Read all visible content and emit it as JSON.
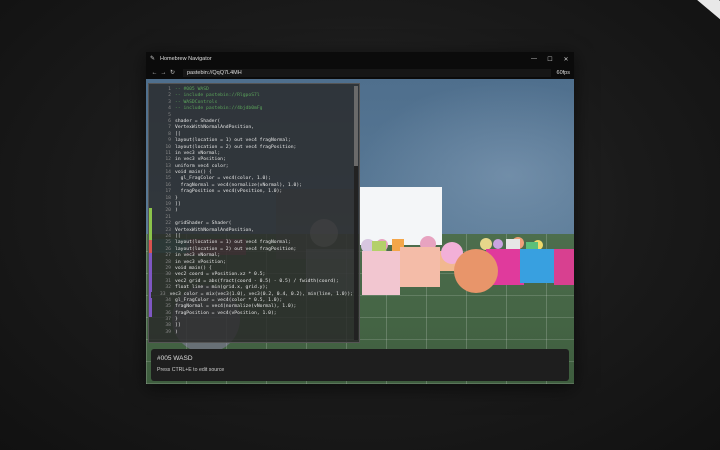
{
  "window": {
    "title": "Homebrew Navigator",
    "controls": {
      "minimize": "—",
      "maximize": "☐",
      "close": "✕"
    }
  },
  "navbar": {
    "back": "←",
    "forward": "→",
    "reload": "↻",
    "url": "pastebin://QqQ7L4MH",
    "fps": "60fps"
  },
  "editor": {
    "lines": [
      {
        "n": "1",
        "text": "-- #005 WASD",
        "type": "comment",
        "marker": ""
      },
      {
        "n": "2",
        "text": "-- include pastebin://RlgpoS7l",
        "type": "comment",
        "marker": ""
      },
      {
        "n": "3",
        "text": "-- WASDControls",
        "type": "comment",
        "marker": ""
      },
      {
        "n": "4",
        "text": "-- include pastebin://4bjdb0mFg",
        "type": "comment",
        "marker": ""
      },
      {
        "n": "5",
        "text": "",
        "type": "code",
        "marker": ""
      },
      {
        "n": "6",
        "text": "shader = Shader(",
        "type": "code",
        "marker": ""
      },
      {
        "n": "7",
        "text": "VertexWithNormalAndPosition,",
        "type": "code",
        "marker": ""
      },
      {
        "n": "8",
        "text": "[[",
        "type": "code",
        "marker": ""
      },
      {
        "n": "9",
        "text": "layout(location = 1) out vec4 fragNormal;",
        "type": "code",
        "marker": ""
      },
      {
        "n": "10",
        "text": "layout(location = 2) out vec4 fragPosition;",
        "type": "code",
        "marker": ""
      },
      {
        "n": "11",
        "text": "in vec3 vNormal;",
        "type": "code",
        "marker": ""
      },
      {
        "n": "12",
        "text": "in vec3 vPosition;",
        "type": "code",
        "marker": ""
      },
      {
        "n": "13",
        "text": "uniform vec4 color;",
        "type": "code",
        "marker": ""
      },
      {
        "n": "14",
        "text": "void main() {",
        "type": "code",
        "marker": ""
      },
      {
        "n": "15",
        "text": "  gl_FragColor = vec4(color, 1.0);",
        "type": "code",
        "marker": ""
      },
      {
        "n": "16",
        "text": "  fragNormal = vec4(normalize(vNormal), 1.0);",
        "type": "code",
        "marker": ""
      },
      {
        "n": "17",
        "text": "  fragPosition = vec4(vPosition, 1.0);",
        "type": "code",
        "marker": ""
      },
      {
        "n": "18",
        "text": "}",
        "type": "code",
        "marker": ""
      },
      {
        "n": "19",
        "text": "]]",
        "type": "code",
        "marker": ""
      },
      {
        "n": "20",
        "text": ")",
        "type": "code",
        "marker": "#8bc34a"
      },
      {
        "n": "21",
        "text": "",
        "type": "code",
        "marker": "#8bc34a"
      },
      {
        "n": "22",
        "text": "gridShader = Shader(",
        "type": "code",
        "marker": "#8bc34a"
      },
      {
        "n": "23",
        "text": "VertexWithNormalAndPosition,",
        "type": "code",
        "marker": "#8bc34a"
      },
      {
        "n": "24",
        "text": "[[",
        "type": "code",
        "marker": "#8bc34a"
      },
      {
        "n": "25",
        "text": "layout(location = 1) out vec4 fragNormal;",
        "type": "code",
        "marker": "#d9534f"
      },
      {
        "n": "26",
        "text": "layout(location = 2) out vec4 fragPosition;",
        "type": "code",
        "marker": "#d9534f"
      },
      {
        "n": "27",
        "text": "in vec3 vNormal;",
        "type": "code",
        "marker": "#7e57c2"
      },
      {
        "n": "28",
        "text": "in vec3 vPosition;",
        "type": "code",
        "marker": "#7e57c2"
      },
      {
        "n": "29",
        "text": "void main() {",
        "type": "code",
        "marker": "#7e57c2"
      },
      {
        "n": "30",
        "text": "vec2 coord = vPosition.xz * 0.5;",
        "type": "code",
        "marker": "#7e57c2"
      },
      {
        "n": "31",
        "text": "vec2 grid = abs(fract(coord - 0.5) - 0.5) / fwidth(coord);",
        "type": "code",
        "marker": "#7e57c2"
      },
      {
        "n": "32",
        "text": "float line = min(grid.x, grid.y);",
        "type": "code",
        "marker": "#7e57c2"
      },
      {
        "n": "33",
        "text": "vec3 color = mix(vec3(1.0), vec3(0.2, 0.4, 0.2), min(line, 1.0));",
        "type": "code",
        "marker": "#7e57c2"
      },
      {
        "n": "34",
        "text": "gl_FragColor = vec4(color * 0.5, 1.0);",
        "type": "code",
        "marker": "#7e57c2"
      },
      {
        "n": "35",
        "text": "fragNormal = vec4(normalize(vNormal), 1.0);",
        "type": "code",
        "marker": "#7e57c2"
      },
      {
        "n": "36",
        "text": "fragPosition = vec4(vPosition, 1.0);",
        "type": "code",
        "marker": "#7e57c2"
      },
      {
        "n": "37",
        "text": "}",
        "type": "code",
        "marker": ""
      },
      {
        "n": "38",
        "text": "]]",
        "type": "code",
        "marker": ""
      },
      {
        "n": "39",
        "text": ")",
        "type": "code",
        "marker": ""
      }
    ]
  },
  "info": {
    "title": "#005 WASD",
    "hint": "Press CTRL+E to edit source"
  },
  "colors": {
    "sky": "#5d7d99",
    "floor": "#4d6e4d",
    "comment": "#5aa35a"
  }
}
